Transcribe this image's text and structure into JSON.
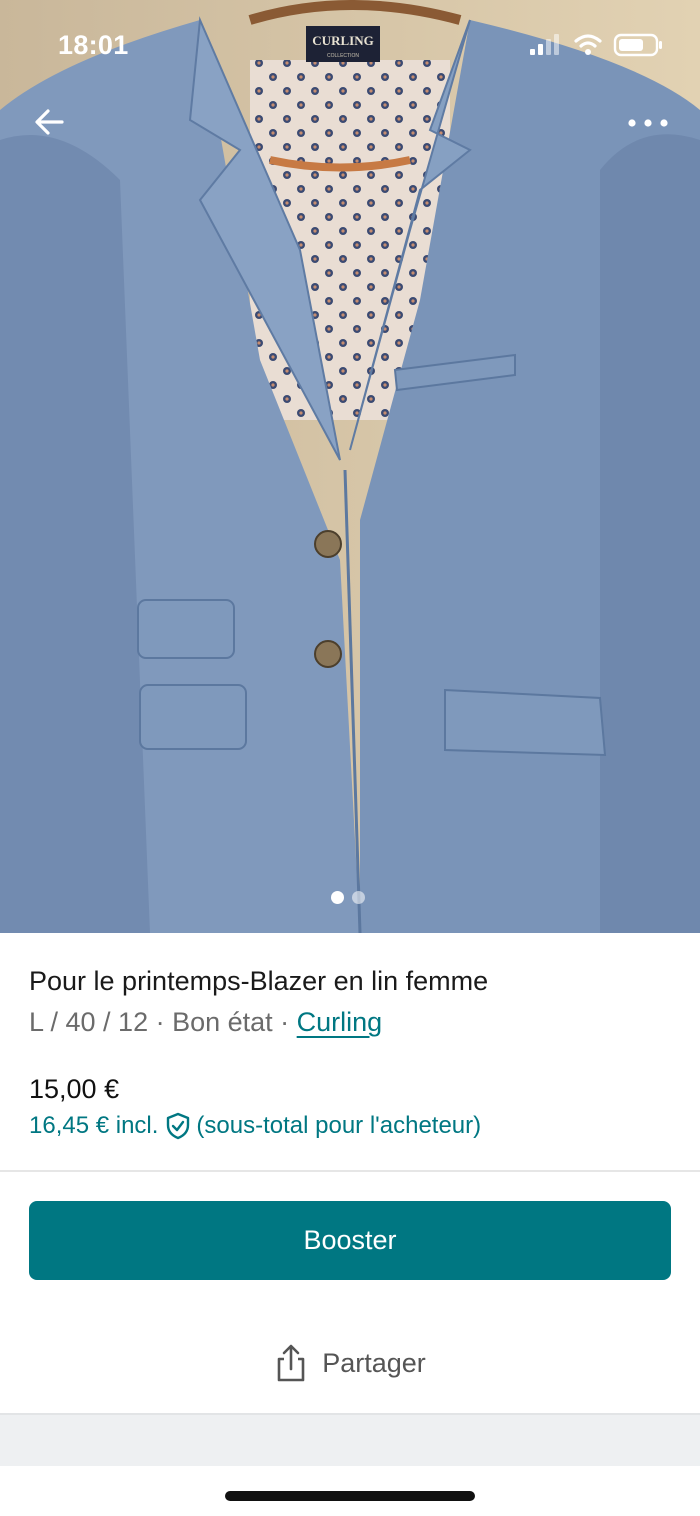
{
  "status_bar": {
    "time": "18:01"
  },
  "photo": {
    "label_brand": "CURLING",
    "label_sub": "COLLECTION",
    "image_count": 2,
    "active_index": 1
  },
  "product": {
    "title": "Pour le printemps-Blazer en lin femme",
    "details": "L / 40 / 12 · Bon état · ",
    "brand": "Curling",
    "price": "15,00 €",
    "price_incl": "16,45 € incl.",
    "price_incl_note": "(sous-total pour l'acheteur)"
  },
  "actions": {
    "booster_label": "Booster",
    "share_label": "Partager"
  },
  "colors": {
    "accent": "#007782",
    "jacket": "#7f9bbd",
    "lining": "#e8ddd4"
  }
}
